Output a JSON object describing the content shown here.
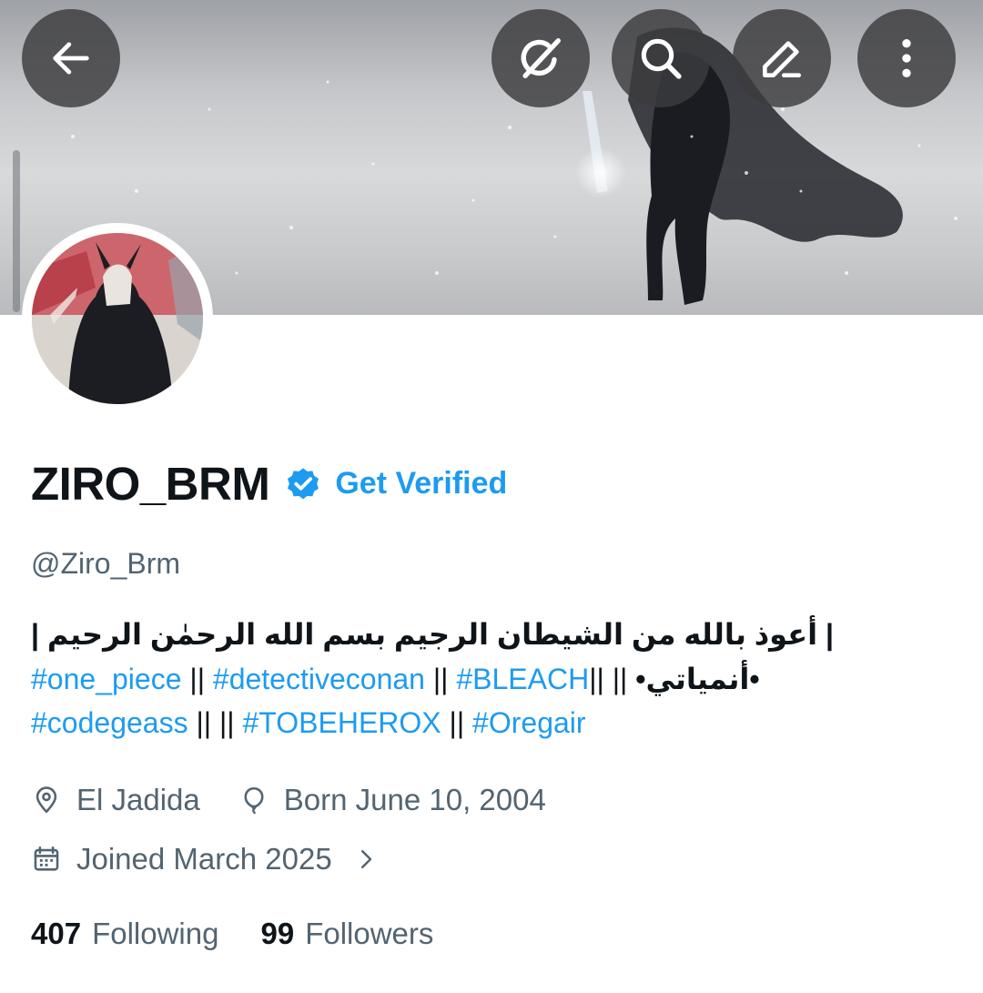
{
  "header": {
    "back_icon": "arrow-left-icon",
    "grok_icon": "grok-icon",
    "search_icon": "search-icon",
    "edit_icon": "edit-icon",
    "more_icon": "more-vertical-icon",
    "button_bg": "#3c3c3e"
  },
  "profile": {
    "display_name": "ZIRO_BRM",
    "get_verified": "Get Verified",
    "handle": "@Ziro_Brm",
    "accent_color": "#1d9bf0"
  },
  "bio": {
    "line1": "| أعوذ بالله من الشيطان الرجيم بسم الله الرحمٰن الرحيم |",
    "line2": {
      "tag1": "#one_piece",
      "sep1": " || ",
      "tag2": "#detectiveconan",
      "sep2": " || ",
      "tag3": "#BLEACH",
      "sep3": "|| || ",
      "arabic": "•أنمياتي•"
    },
    "line3": {
      "tag1": "#codegeass",
      "sep1": " || || ",
      "tag2": "#TOBEHEROX",
      "sep2": " || ",
      "tag3": "#Oregair"
    }
  },
  "meta": {
    "location": "El Jadida",
    "birthday": "Born June 10, 2004",
    "joined": "Joined March 2025",
    "location_icon": "location-pin-icon",
    "birthday_icon": "balloon-icon",
    "joined_icon": "calendar-icon",
    "chevron_icon": "chevron-right-icon"
  },
  "stats": {
    "following_count": "407",
    "following_label": "Following",
    "followers_count": "99",
    "followers_label": "Followers"
  }
}
